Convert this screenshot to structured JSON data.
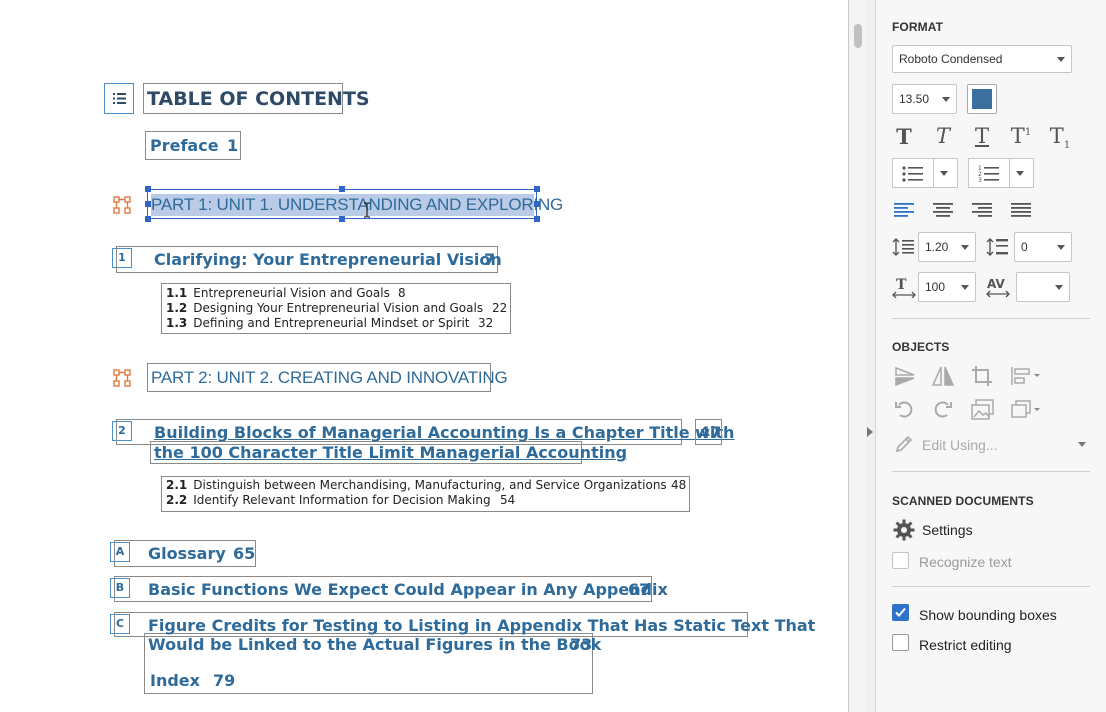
{
  "toc": {
    "heading": "TABLE OF CONTENTS",
    "preface": {
      "title": "Preface",
      "page": "1"
    },
    "part1": "PART 1: UNIT 1. UNDERSTANDING AND EXPLORING",
    "chapter1": {
      "badge": "1",
      "title": "Clarifying: Your Entrepreneurial Vision",
      "page": "7",
      "sections": [
        {
          "num": "1.1",
          "title": "Entrepreneurial Vision and Goals",
          "page": "8"
        },
        {
          "num": "1.2",
          "title": "Designing Your Entrepreneurial Vision and Goals",
          "page": "22"
        },
        {
          "num": "1.3",
          "title": "Defining and Entrepreneurial Mindset or Spirit",
          "page": "32"
        }
      ]
    },
    "part2": "PART 2: UNIT 2. CREATING AND INNOVATING",
    "chapter2": {
      "badge": "2",
      "title_line1": "Building Blocks of Managerial Accounting Is a Chapter Title with",
      "title_line2": "the 100 Character Title Limit Managerial Accounting",
      "page": "47",
      "sections": [
        {
          "num": "2.1",
          "title": "Distinguish between Merchandising, Manufacturing, and Service Organizations",
          "page": "48"
        },
        {
          "num": "2.2",
          "title": "Identify Relevant Information for Decision Making",
          "page": "54"
        }
      ]
    },
    "appendixA": {
      "badge": "A",
      "title": "Glossary",
      "page": "65"
    },
    "appendixB": {
      "badge": "B",
      "title": "Basic Functions We Expect Could Appear in Any Appendix",
      "page": "67"
    },
    "appendixC": {
      "badge": "C",
      "title_line1": "Figure Credits for Testing to Listing in Appendix That Has Static Text That",
      "title_line2": "Would be Linked to the Actual Figures in the Book",
      "page": "73"
    },
    "index": {
      "title": "Index",
      "page": "79"
    }
  },
  "panel": {
    "format_title": "FORMAT",
    "font_family": "Roboto Condensed",
    "font_size": "13.50",
    "text_color": "#3a6f9e",
    "line_spacing": "1.20",
    "para_spacing": "0",
    "scale": "100",
    "char_spacing": "",
    "objects_title": "OBJECTS",
    "edit_using": "Edit Using...",
    "scanned_title": "SCANNED DOCUMENTS",
    "settings_label": "Settings",
    "recognize_label": "Recognize text",
    "show_bbox_label": "Show bounding boxes",
    "show_bbox_checked": true,
    "restrict_label": "Restrict editing",
    "restrict_checked": false
  }
}
